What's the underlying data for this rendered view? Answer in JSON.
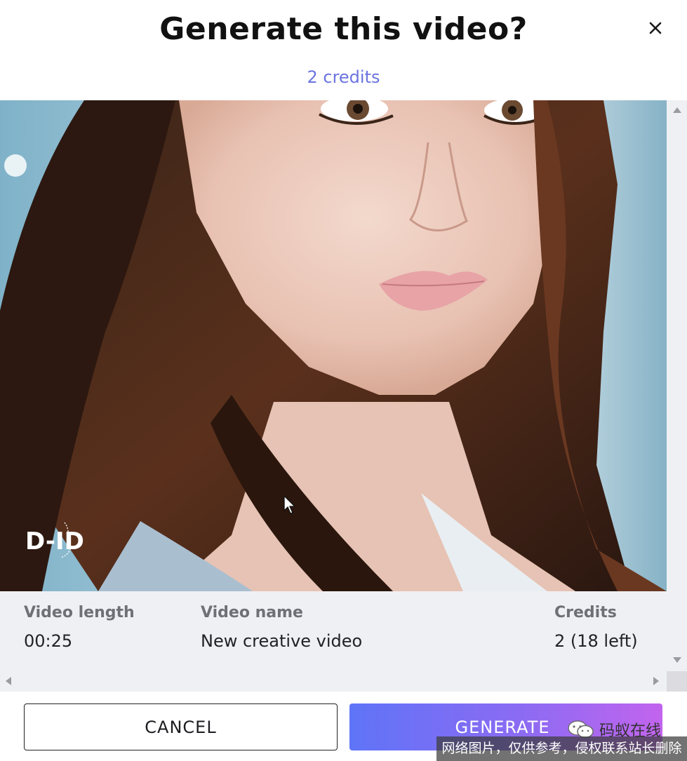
{
  "dialog": {
    "title": "Generate this video?",
    "credits_label": "2 credits",
    "close_icon": "close-icon"
  },
  "preview": {
    "logo_text": "D-ID",
    "subject": "portrait-photo"
  },
  "info": {
    "length_label": "Video length",
    "length_value": "00:25",
    "name_label": "Video name",
    "name_value": "New creative video",
    "credits_label": "Credits",
    "credits_value": "2 (18 left)"
  },
  "footer": {
    "cancel_label": "CANCEL",
    "generate_label": "GENERATE"
  },
  "overlay": {
    "wechat_label": "码蚁在线",
    "notice": "网络图片，仅供参考，侵权联系站长删除"
  },
  "colors": {
    "accent": "#6b74e0",
    "generate_start": "#5f74f7",
    "generate_end": "#c264ee"
  }
}
